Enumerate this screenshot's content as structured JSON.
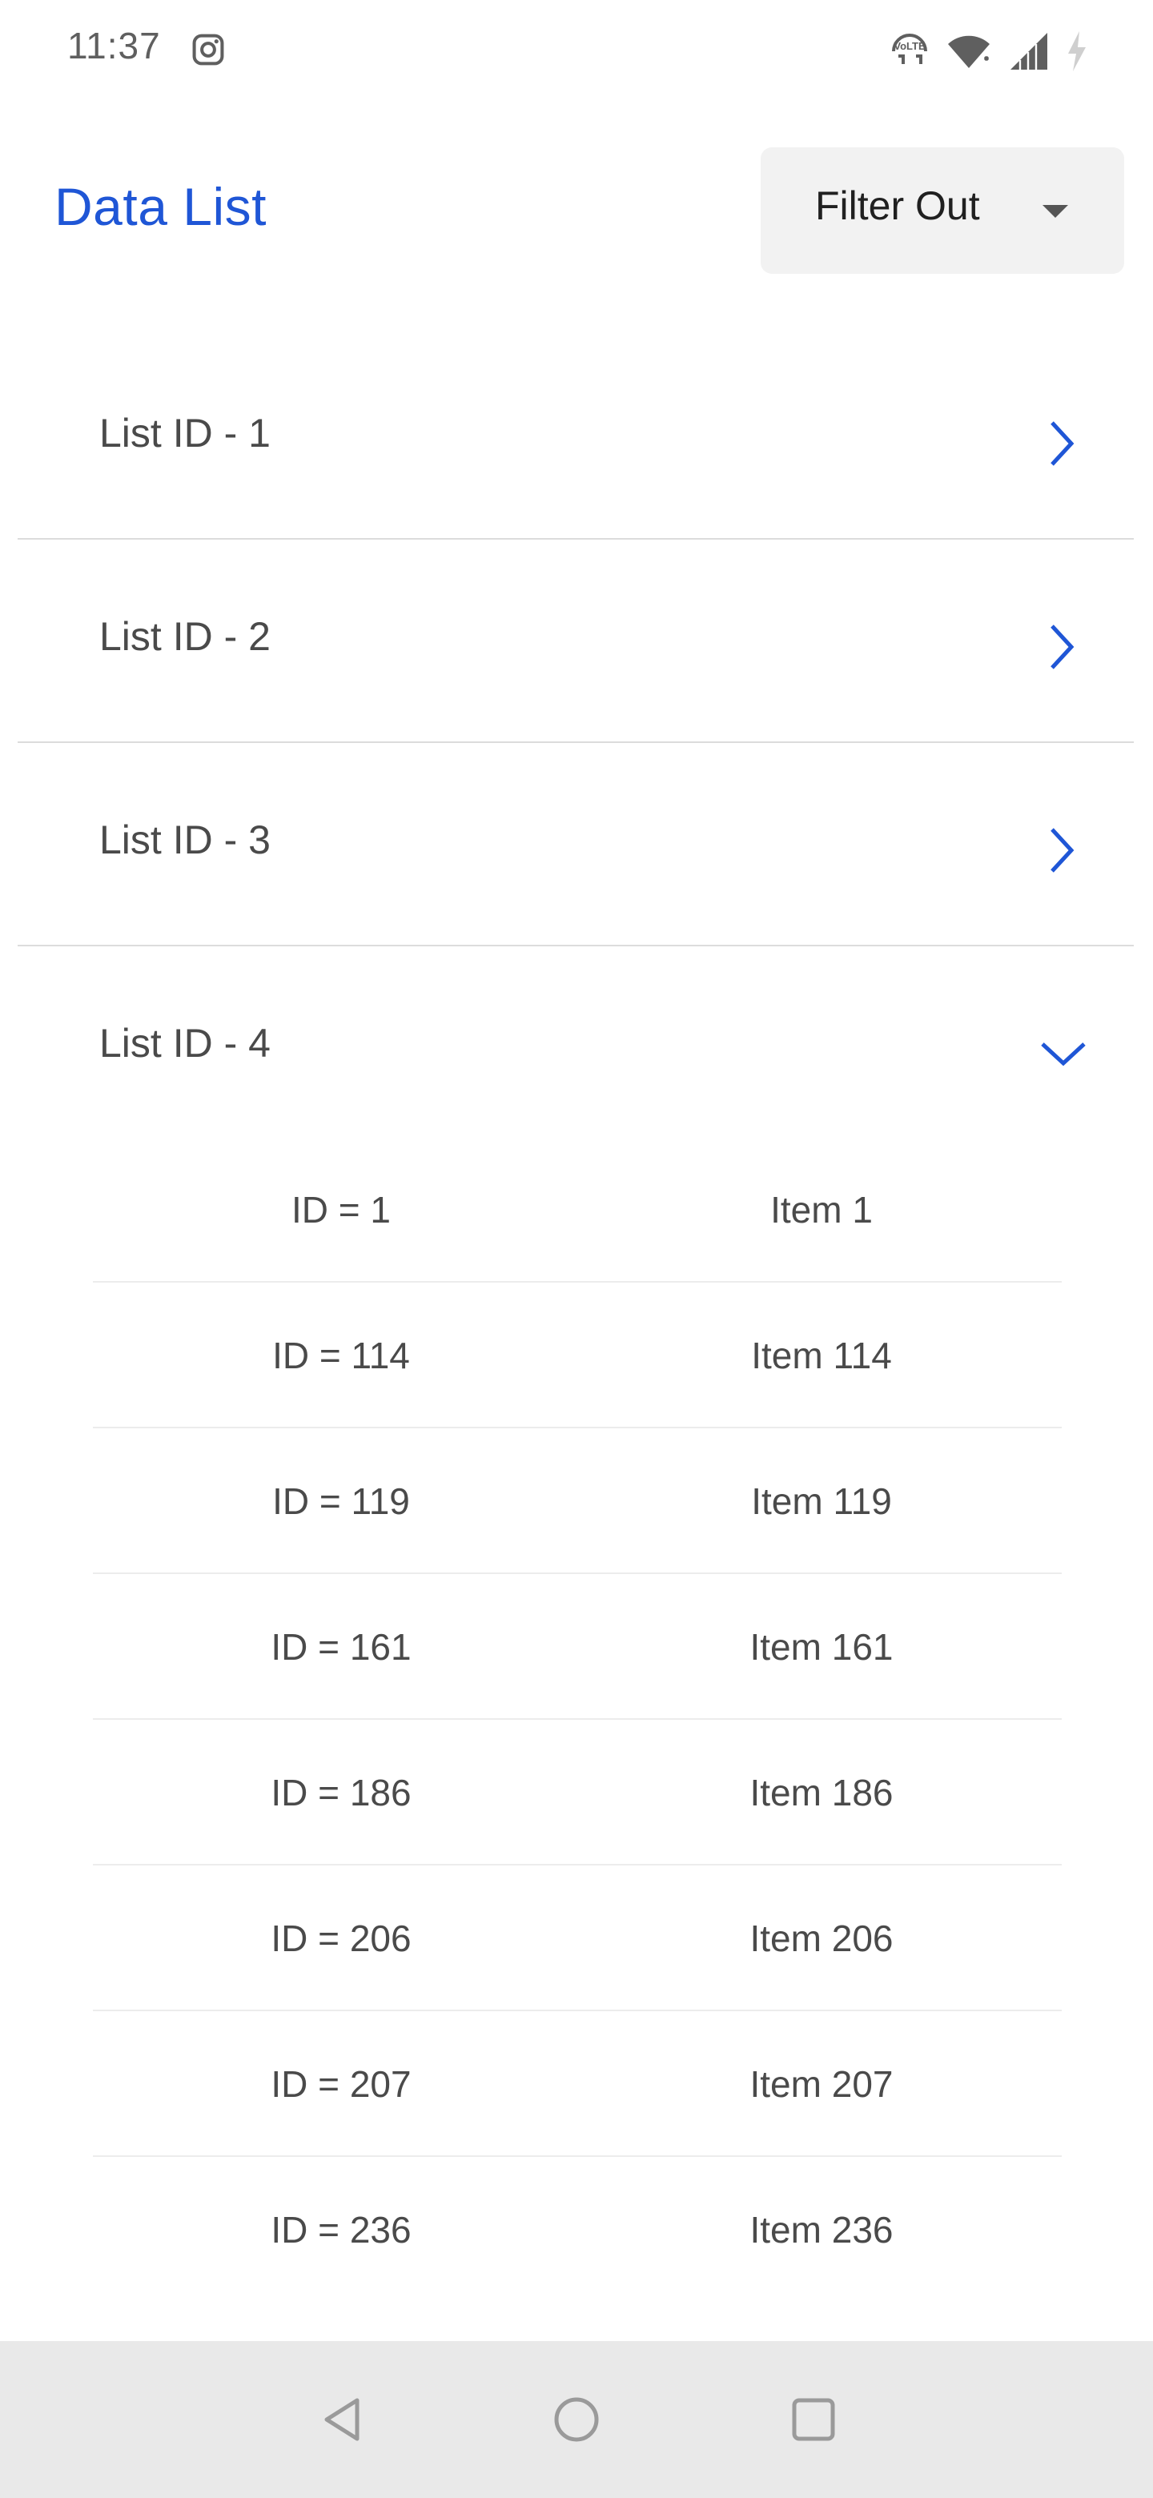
{
  "status_bar": {
    "time": "11:37",
    "icons": [
      "instagram-icon",
      "volte-icon",
      "wifi-icon",
      "signal-icon",
      "battery-charging-icon"
    ],
    "volte_text": "VoLTE"
  },
  "header": {
    "title": "Data List",
    "filter_label": "Filter Out",
    "accent_color": "#1f56d6"
  },
  "lists": [
    {
      "label": "List ID - 1",
      "expanded": false
    },
    {
      "label": "List ID - 2",
      "expanded": false
    },
    {
      "label": "List ID - 3",
      "expanded": false
    },
    {
      "label": "List ID - 4",
      "expanded": true
    }
  ],
  "items": [
    {
      "id": "ID = 1",
      "name": "Item 1"
    },
    {
      "id": "ID = 114",
      "name": "Item 114"
    },
    {
      "id": "ID = 119",
      "name": "Item 119"
    },
    {
      "id": "ID = 161",
      "name": "Item 161"
    },
    {
      "id": "ID = 186",
      "name": "Item 186"
    },
    {
      "id": "ID = 206",
      "name": "Item 206"
    },
    {
      "id": "ID = 207",
      "name": "Item 207"
    },
    {
      "id": "ID = 236",
      "name": "Item 236"
    }
  ],
  "nav_bar": {
    "buttons": [
      "back-icon",
      "home-icon",
      "recents-icon"
    ]
  }
}
